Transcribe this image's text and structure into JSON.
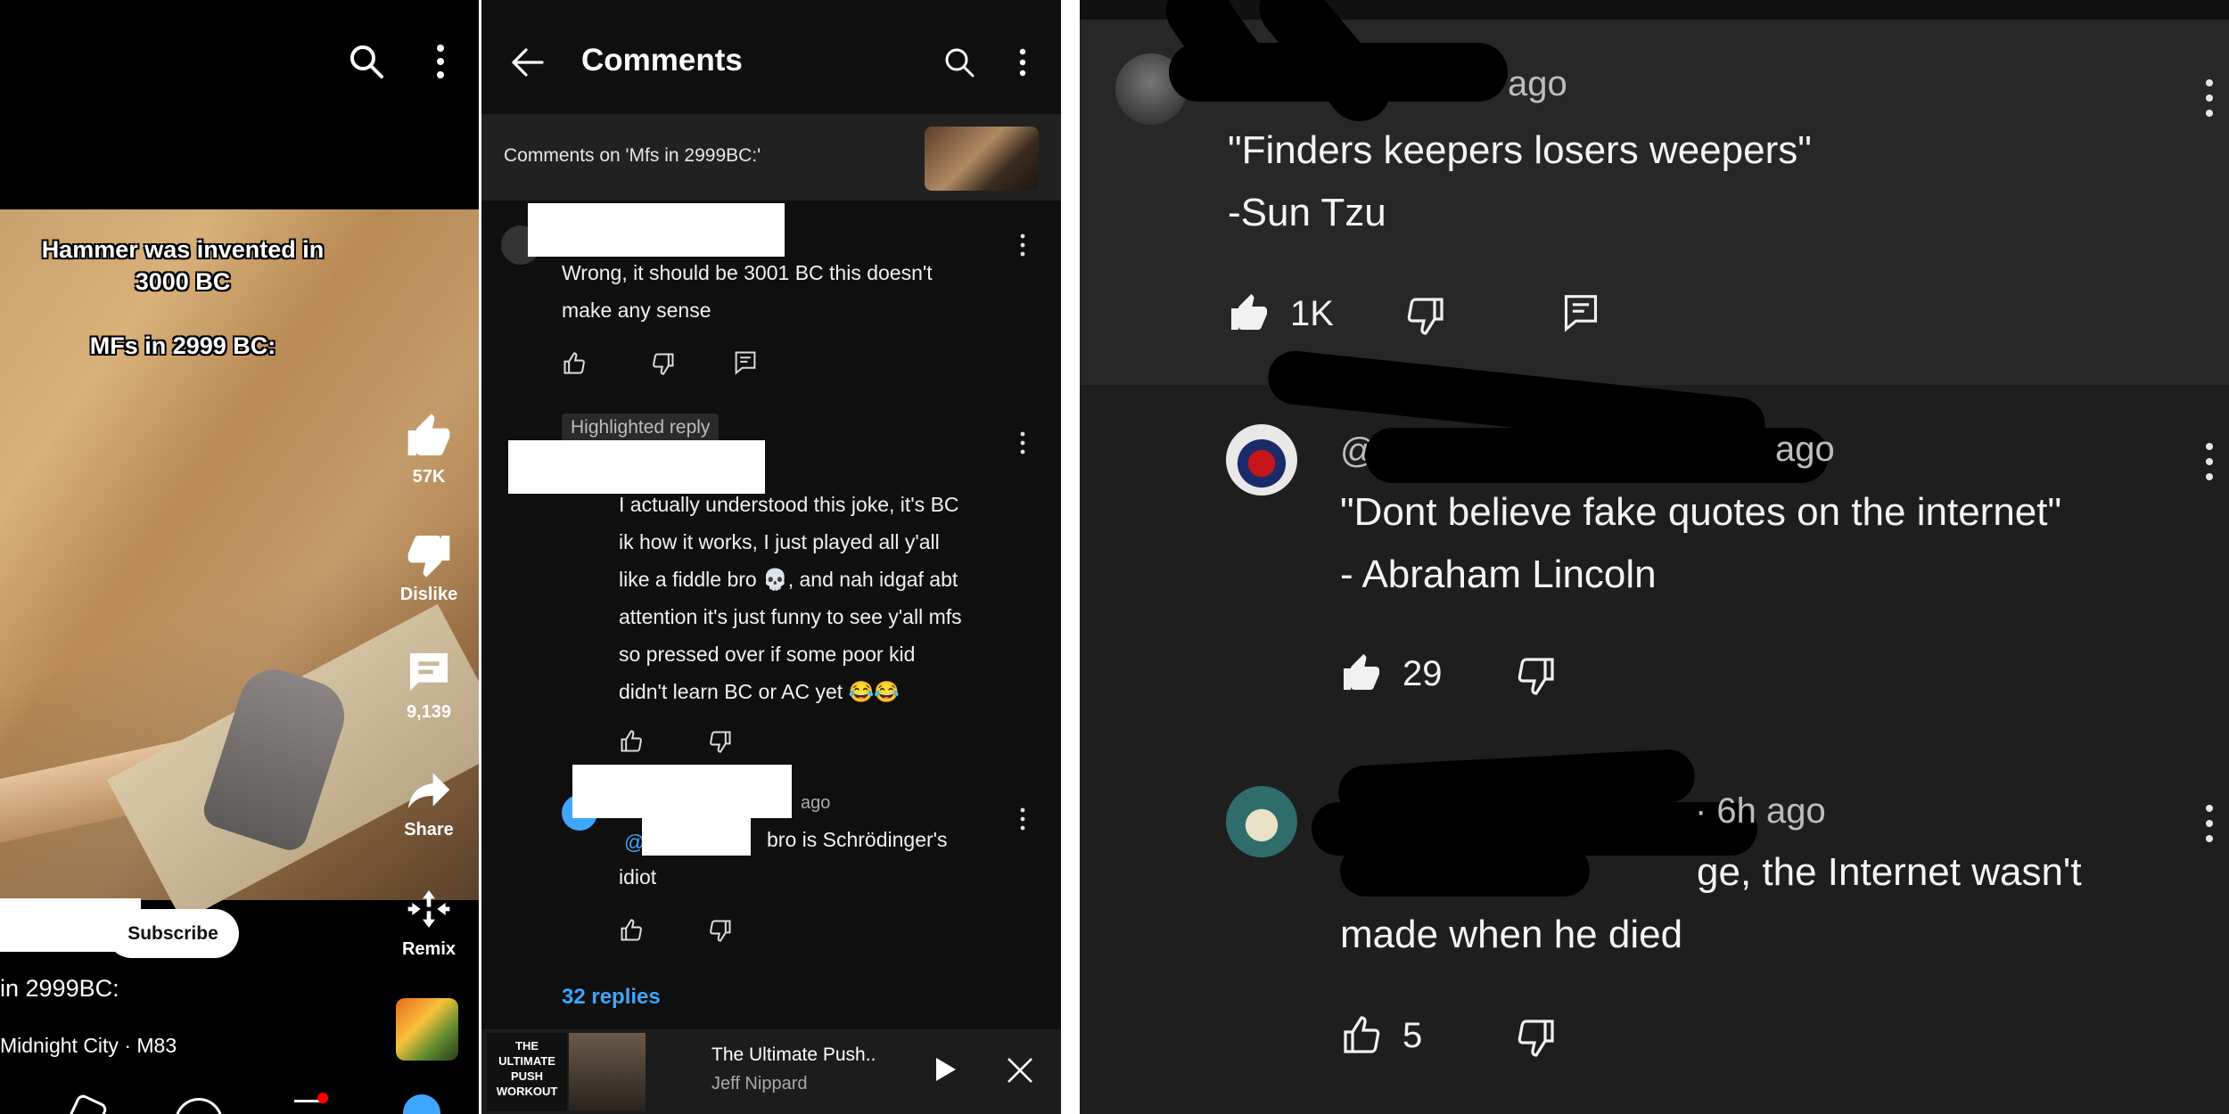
{
  "shorts": {
    "overlay_line1": "Hammer was invented in",
    "overlay_line2": "3000 BC",
    "overlay_line3": "MFs in 2999 BC:",
    "like_count": "57K",
    "dislike_label": "Dislike",
    "comment_count": "9,139",
    "share_label": "Share",
    "remix_label": "Remix",
    "subscribe_label": "Subscribe",
    "caption": "in 2999BC:",
    "music": "Midnight City · M83"
  },
  "comments_panel": {
    "title": "Comments",
    "context": "Comments on 'Mfs in 2999BC:'",
    "comment1_text_1": "Wrong, it should be 3001 BC this doesn't",
    "comment1_text_2": "make any sense",
    "highlighted_badge": "Highlighted reply",
    "reply_lines": [
      "I actually understood this joke, it's BC",
      "ik how it works, I just played all y'all",
      "like a fiddle bro 💀, and nah idgaf abt",
      "attention it's just funny to see y'all mfs",
      "so pressed over if some poor kid",
      "didn't learn BC or AC yet 😂😂"
    ],
    "reply2_time": "ago",
    "reply2_text_a": "bro is Schrödinger's",
    "reply2_text_b": "idiot",
    "replies_link": "32 replies",
    "mini_player": {
      "thumb_text": "THE ULTIMATE PUSH WORKOUT",
      "title": "The Ultimate Push..",
      "channel": "Jeff Nippard"
    }
  },
  "zoom": {
    "c1_time": "ago",
    "c1_line1": "\"Finders keepers losers weepers\"",
    "c1_line2": "-Sun Tzu",
    "c1_likes": "1K",
    "c2_handle": "@",
    "c2_time": "ago",
    "c2_line1": "\"Dont believe fake quotes on the internet\"",
    "c2_line2": "- Abraham Lincoln",
    "c2_likes": "29",
    "c3_time": "· 6h ago",
    "c3_line1": "ge, the Internet wasn't",
    "c3_line2": "made when he died",
    "c3_likes": "5"
  },
  "icons": [
    "search-icon",
    "more-vert-icon",
    "back-arrow-icon",
    "thumb-up-icon",
    "thumb-down-icon",
    "comment-icon",
    "share-icon",
    "remix-icon",
    "play-icon",
    "close-icon"
  ]
}
